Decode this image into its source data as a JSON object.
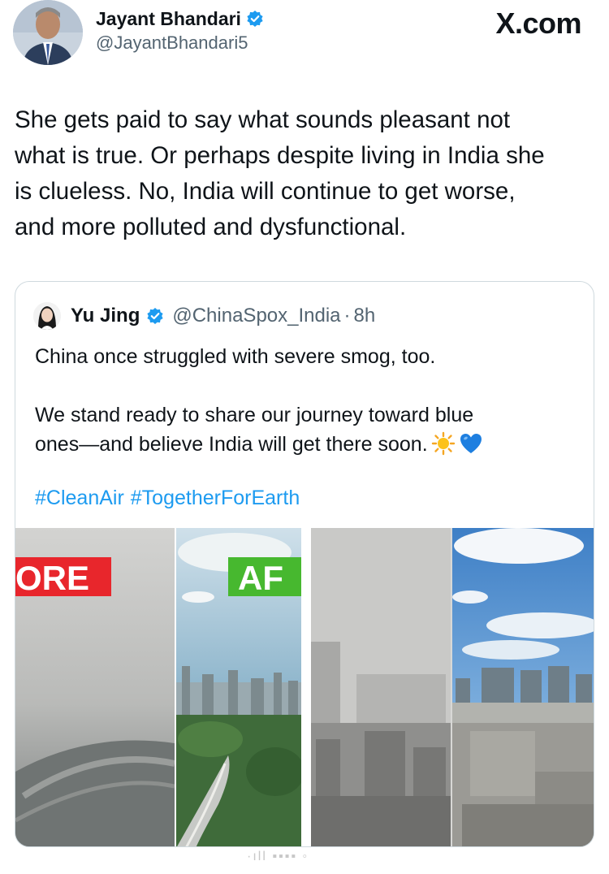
{
  "site_logo": "X.com",
  "author": {
    "name": "Jayant Bhandari",
    "handle": "@JayantBhandari5"
  },
  "tweet": {
    "lines": [
      "She gets paid to say what sounds pleasant not",
      "what is true. Or perhaps despite living in India she",
      "is clueless. No, India will continue to get worse,",
      "and more polluted and dysfunctional."
    ]
  },
  "quote": {
    "name": "Yu Jing",
    "handle": "@ChinaSpox_India",
    "separator": "·",
    "time": "8h",
    "paragraph1": "China once struggled with severe smog, too.",
    "paragraph2_line1": "We stand ready to share our journey toward blue",
    "paragraph2_line2": "ones—and  believe India will get there soon.",
    "emojis": [
      "sun-emoji",
      "blue-heart-emoji"
    ],
    "hashtags": [
      "#CleanAir",
      "#TogetherForEarth"
    ],
    "media": {
      "label_before": "ORE",
      "label_after": "AF"
    }
  },
  "colors": {
    "verified_blue": "#1d9bf0",
    "link_blue": "#1d9bf0",
    "secondary_text": "#536471",
    "before_label_red": "#e8262c",
    "after_label_green": "#47b82f"
  }
}
